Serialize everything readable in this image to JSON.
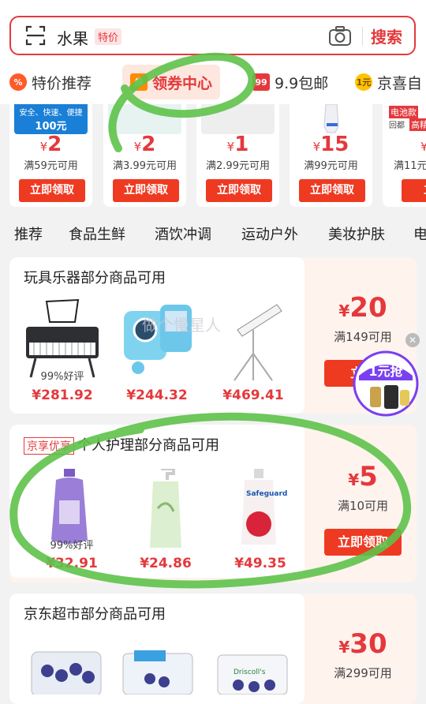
{
  "search": {
    "keyword": "水果",
    "tag": "特价",
    "button": "搜索"
  },
  "tabs": [
    {
      "label": "特价推荐",
      "icon": "%"
    },
    {
      "label": "领券中心",
      "icon": "券"
    },
    {
      "label": "9.9包邮",
      "icon": "99"
    },
    {
      "label": "京喜自",
      "icon": "1元"
    }
  ],
  "coupon_banner": {
    "label": "安全、快速、便捷",
    "amount": "100元"
  },
  "coupons": [
    {
      "amount": "2",
      "condition": "满59元可用",
      "button": "立即领取"
    },
    {
      "amount": "2",
      "condition": "满3.99元可用",
      "button": "立即领取"
    },
    {
      "amount": "1",
      "condition": "满2.99元可用",
      "button": "立即领取"
    },
    {
      "amount": "15",
      "condition": "满99元可用",
      "button": "立即领取"
    },
    {
      "amount": "1",
      "condition": "满11元",
      "button": "立即"
    }
  ],
  "coupon_partial": {
    "top": "电池款",
    "sub": "高精",
    "back": "回都"
  },
  "categories": [
    "推荐",
    "食品生鲜",
    "酒饮冲调",
    "运动户外",
    "美妆护肤",
    "电"
  ],
  "currency": "¥",
  "sections": [
    {
      "title": "玩具乐器部分商品可用",
      "badge": "",
      "products": [
        {
          "price": "¥281.92",
          "rating": "99%好评"
        },
        {
          "price": "¥244.32",
          "rating": ""
        },
        {
          "price": "¥469.41",
          "rating": ""
        }
      ],
      "amount": "20",
      "condition": "满149可用",
      "button": "立即"
    },
    {
      "title": "个人护理部分商品可用",
      "badge": "京享优享",
      "products": [
        {
          "price": "¥32.91",
          "rating": "99%好评"
        },
        {
          "price": "¥24.86",
          "rating": ""
        },
        {
          "price": "¥49.35",
          "rating": ""
        }
      ],
      "amount": "5",
      "condition": "满10可用",
      "button": "立即领取"
    },
    {
      "title": "京东超市部分商品可用",
      "badge": "",
      "products": [],
      "amount": "30",
      "condition": "满299可用",
      "button": ""
    }
  ],
  "floating_ad": {
    "label": "1元抢"
  },
  "watermark": "做个慢星人",
  "product_text": {
    "brand": "Safeguard",
    "berry": "Driscoll's"
  },
  "colors": {
    "accent": "#e4393c",
    "button": "#ef3a22",
    "annotation": "#5ec24a"
  }
}
